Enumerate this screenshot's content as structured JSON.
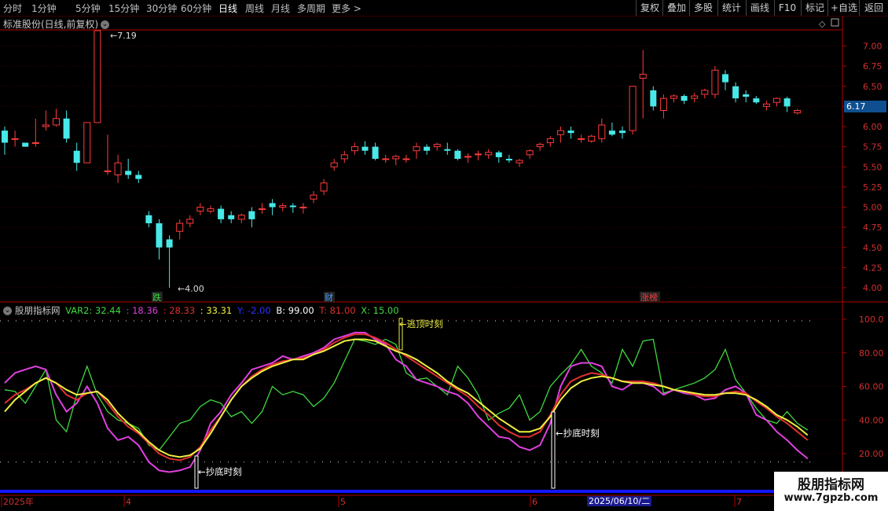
{
  "toolbar": {
    "periods": [
      "分时",
      "1分钟",
      "5分钟",
      "15分钟",
      "30分钟",
      "60分钟",
      "日线",
      "周线",
      "月线",
      "多周期",
      "更多"
    ],
    "active": "日线",
    "right_buttons": [
      "复权",
      "叠加",
      "多股",
      "统计",
      "画线",
      "F10",
      "标记",
      "+自选",
      "返回"
    ]
  },
  "main_chart": {
    "title": "标准股份(日线,前复权)",
    "y_ticks": [
      "7.00",
      "6.75",
      "6.50",
      "6.25",
      "6.00",
      "5.75",
      "5.50",
      "5.25",
      "5.00",
      "4.75",
      "4.50",
      "4.25",
      "4.00"
    ],
    "high_label": "7.19",
    "low_label": "4.00",
    "current_price": "6.17",
    "markers": [
      "跌",
      "财",
      "涨榜"
    ],
    "candles": [
      [
        5.95,
        6.0,
        5.8,
        5.65
      ],
      [
        5.85,
        5.95,
        5.85,
        5.75
      ],
      [
        5.8,
        5.8,
        5.75,
        5.75
      ],
      [
        5.8,
        6.1,
        5.8,
        5.75
      ],
      [
        6.0,
        6.2,
        6.02,
        5.95
      ],
      [
        6.02,
        6.22,
        6.1,
        6.0
      ],
      [
        6.1,
        6.2,
        5.85,
        5.8
      ],
      [
        5.7,
        5.8,
        5.55,
        5.45
      ],
      [
        5.55,
        6.05,
        6.05,
        5.55
      ],
      [
        6.05,
        7.19,
        7.19,
        6.05
      ],
      [
        5.45,
        5.9,
        5.45,
        5.4
      ],
      [
        5.4,
        5.65,
        5.55,
        5.3
      ],
      [
        5.45,
        5.6,
        5.4,
        5.35
      ],
      [
        5.4,
        5.45,
        5.35,
        5.3
      ],
      [
        4.9,
        4.95,
        4.8,
        4.75
      ],
      [
        4.8,
        4.85,
        4.5,
        4.35
      ],
      [
        4.6,
        4.65,
        4.5,
        4.0
      ],
      [
        4.7,
        4.85,
        4.8,
        4.6
      ],
      [
        4.8,
        4.9,
        4.85,
        4.75
      ],
      [
        4.95,
        5.05,
        5.0,
        4.9
      ],
      [
        4.95,
        5.02,
        4.98,
        4.92
      ],
      [
        4.98,
        5.02,
        4.85,
        4.8
      ],
      [
        4.9,
        4.95,
        4.85,
        4.8
      ],
      [
        4.85,
        4.92,
        4.9,
        4.8
      ],
      [
        4.95,
        5.0,
        4.85,
        4.75
      ],
      [
        4.98,
        5.05,
        4.98,
        4.92
      ],
      [
        5.05,
        5.1,
        5.0,
        4.9
      ],
      [
        5.0,
        5.05,
        5.02,
        4.95
      ],
      [
        5.02,
        5.05,
        5.0,
        4.93
      ],
      [
        5.0,
        5.05,
        5.0,
        4.92
      ],
      [
        5.1,
        5.2,
        5.15,
        5.05
      ],
      [
        5.2,
        5.35,
        5.3,
        5.15
      ],
      [
        5.5,
        5.6,
        5.55,
        5.45
      ],
      [
        5.6,
        5.7,
        5.65,
        5.55
      ],
      [
        5.7,
        5.8,
        5.75,
        5.65
      ],
      [
        5.75,
        5.82,
        5.7,
        5.65
      ],
      [
        5.75,
        5.8,
        5.6,
        5.58
      ],
      [
        5.6,
        5.65,
        5.6,
        5.55
      ],
      [
        5.6,
        5.65,
        5.63,
        5.52
      ],
      [
        5.6,
        5.65,
        5.6,
        5.55
      ],
      [
        5.7,
        5.8,
        5.75,
        5.6
      ],
      [
        5.75,
        5.78,
        5.7,
        5.65
      ],
      [
        5.75,
        5.8,
        5.78,
        5.7
      ],
      [
        5.72,
        5.8,
        5.7,
        5.65
      ],
      [
        5.7,
        5.72,
        5.6,
        5.58
      ],
      [
        5.62,
        5.67,
        5.63,
        5.55
      ],
      [
        5.65,
        5.7,
        5.66,
        5.58
      ],
      [
        5.65,
        5.72,
        5.68,
        5.6
      ],
      [
        5.68,
        5.7,
        5.62,
        5.55
      ],
      [
        5.6,
        5.65,
        5.58,
        5.55
      ],
      [
        5.55,
        5.6,
        5.58,
        5.5
      ],
      [
        5.65,
        5.72,
        5.7,
        5.6
      ],
      [
        5.75,
        5.8,
        5.78,
        5.7
      ],
      [
        5.8,
        5.88,
        5.85,
        5.75
      ],
      [
        5.9,
        6.0,
        5.95,
        5.8
      ],
      [
        5.95,
        6.0,
        5.92,
        5.85
      ],
      [
        5.85,
        5.9,
        5.85,
        5.8
      ],
      [
        5.82,
        5.9,
        5.88,
        5.8
      ],
      [
        5.85,
        6.1,
        6.02,
        5.8
      ],
      [
        5.95,
        6.05,
        5.9,
        5.88
      ],
      [
        5.95,
        6.0,
        5.92,
        5.85
      ],
      [
        5.95,
        6.5,
        6.5,
        5.9
      ],
      [
        6.6,
        6.95,
        6.65,
        6.1
      ],
      [
        6.45,
        6.5,
        6.25,
        6.2
      ],
      [
        6.2,
        6.4,
        6.35,
        6.1
      ],
      [
        6.35,
        6.4,
        6.38,
        6.3
      ],
      [
        6.38,
        6.4,
        6.32,
        6.28
      ],
      [
        6.35,
        6.42,
        6.38,
        6.3
      ],
      [
        6.4,
        6.47,
        6.45,
        6.35
      ],
      [
        6.4,
        6.75,
        6.7,
        6.35
      ],
      [
        6.65,
        6.7,
        6.55,
        6.45
      ],
      [
        6.5,
        6.55,
        6.35,
        6.3
      ],
      [
        6.4,
        6.45,
        6.37,
        6.3
      ],
      [
        6.35,
        6.38,
        6.3,
        6.28
      ],
      [
        6.25,
        6.32,
        6.28,
        6.2
      ],
      [
        6.3,
        6.36,
        6.35,
        6.25
      ],
      [
        6.35,
        6.37,
        6.25,
        6.18
      ],
      [
        6.17,
        6.22,
        6.2,
        6.15
      ]
    ]
  },
  "indicator": {
    "name": "股朋指标网",
    "items": [
      {
        "text": "VAR2: 32.44",
        "color": "#3fd93f"
      },
      {
        "text": ": 18.36",
        "color": "#e040e0"
      },
      {
        "text": ": 28.33",
        "color": "#e03030"
      },
      {
        "text": ": 33.31",
        "color": "#f0f040"
      },
      {
        "text": "Y: -2.00",
        "color": "#3030ff"
      },
      {
        "text": "B: 99.00",
        "color": "#ffffff"
      },
      {
        "text": "T: 81.00",
        "color": "#e03030"
      },
      {
        "text": "X: 15.00",
        "color": "#3fd93f"
      }
    ],
    "y_ticks": [
      "100.0",
      "80.00",
      "60.00",
      "40.00",
      "20.00"
    ],
    "signal_top": "逃顶时刻",
    "signal_bottom": "抄底时刻",
    "series": {
      "green": [
        58,
        57,
        50,
        60,
        70,
        40,
        33,
        55,
        72,
        55,
        45,
        40,
        38,
        35,
        25,
        22,
        30,
        38,
        40,
        48,
        52,
        50,
        42,
        45,
        38,
        45,
        60,
        55,
        57,
        55,
        48,
        53,
        62,
        75,
        88,
        87,
        85,
        88,
        85,
        68,
        64,
        65,
        60,
        55,
        72,
        65,
        55,
        40,
        44,
        47,
        55,
        40,
        45,
        60,
        67,
        73,
        82,
        72,
        68,
        62,
        82,
        72,
        87,
        88,
        56,
        58,
        60,
        62,
        65,
        70,
        82,
        64,
        56,
        47,
        40,
        38,
        45,
        38,
        34
      ],
      "magenta": [
        62,
        68,
        70,
        72,
        70,
        55,
        45,
        50,
        60,
        50,
        35,
        28,
        30,
        25,
        15,
        10,
        9,
        10,
        12,
        22,
        38,
        45,
        55,
        62,
        70,
        72,
        74,
        78,
        76,
        78,
        80,
        83,
        88,
        90,
        92,
        92,
        88,
        85,
        76,
        72,
        64,
        62,
        60,
        57,
        55,
        50,
        42,
        36,
        30,
        29,
        24,
        22,
        25,
        38,
        60,
        72,
        74,
        74,
        72,
        60,
        58,
        62,
        62,
        60,
        55,
        58,
        56,
        55,
        52,
        53,
        58,
        60,
        56,
        43,
        40,
        33,
        28,
        22,
        17
      ],
      "red": [
        50,
        55,
        58,
        62,
        65,
        62,
        55,
        52,
        56,
        57,
        50,
        42,
        36,
        32,
        26,
        20,
        17,
        16,
        18,
        24,
        34,
        42,
        52,
        60,
        66,
        70,
        73,
        75,
        76,
        77,
        79,
        82,
        86,
        89,
        91,
        91,
        89,
        86,
        82,
        78,
        74,
        70,
        66,
        62,
        58,
        54,
        48,
        43,
        37,
        33,
        30,
        30,
        33,
        43,
        55,
        63,
        66,
        68,
        67,
        65,
        63,
        63,
        63,
        62,
        60,
        58,
        57,
        55,
        54,
        54,
        56,
        57,
        56,
        51,
        47,
        42,
        38,
        33,
        28
      ],
      "yellow": [
        45,
        52,
        57,
        62,
        65,
        62,
        58,
        55,
        56,
        57,
        52,
        44,
        38,
        33,
        27,
        22,
        19,
        18,
        19,
        23,
        32,
        42,
        52,
        60,
        65,
        69,
        72,
        74,
        76,
        76,
        79,
        81,
        84,
        87,
        88,
        88,
        87,
        84,
        81,
        79,
        76,
        72,
        68,
        63,
        59,
        56,
        51,
        46,
        41,
        37,
        33,
        33,
        35,
        42,
        52,
        59,
        63,
        65,
        66,
        65,
        63,
        62,
        62,
        61,
        60,
        58,
        57,
        56,
        55,
        55,
        56,
        56,
        55,
        52,
        48,
        43,
        40,
        36,
        31
      ]
    }
  },
  "time_axis": {
    "labels": [
      "2025年",
      "4",
      "5",
      "6",
      "7"
    ],
    "cursor_date": "2025/06/10/二"
  },
  "brand": {
    "name": "股朋指标网",
    "url": "www.7gpzb.com"
  },
  "colors": {
    "up": "#ff3b3b",
    "down": "#48e8e8",
    "grid": "#7a0000",
    "axis": "#b00000"
  }
}
